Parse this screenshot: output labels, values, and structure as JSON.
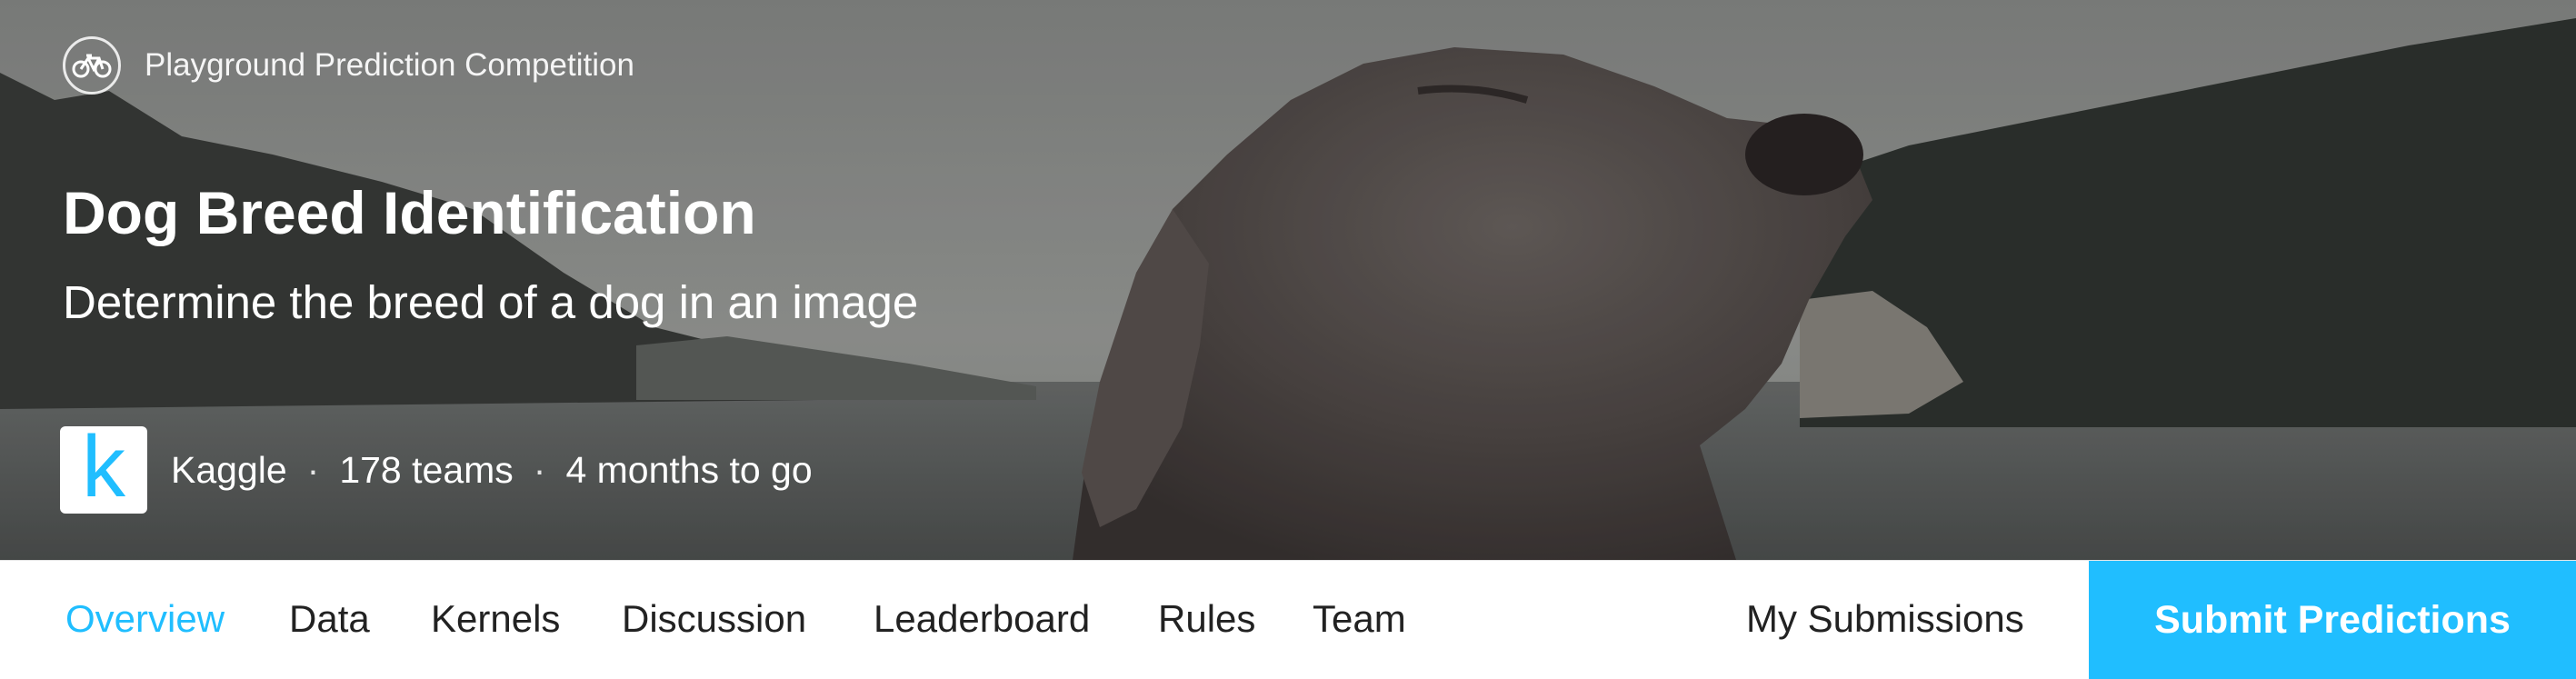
{
  "hero": {
    "competition_type": "Playground Prediction Competition",
    "type_icon": "bicycle-icon",
    "title": "Dog Breed Identification",
    "subtitle": "Determine the breed of a dog in an image",
    "host_logo_letter": "k",
    "host": "Kaggle",
    "separator": "·",
    "teams": "178 teams",
    "deadline": "4 months to go"
  },
  "nav": {
    "tabs": [
      "Overview",
      "Data",
      "Kernels",
      "Discussion",
      "Leaderboard",
      "Rules",
      "Team"
    ],
    "active_tab": "Overview",
    "my_submissions": "My Submissions",
    "submit": "Submit Predictions"
  },
  "colors": {
    "accent": "#20beff",
    "text": "#222222",
    "white": "#ffffff"
  }
}
